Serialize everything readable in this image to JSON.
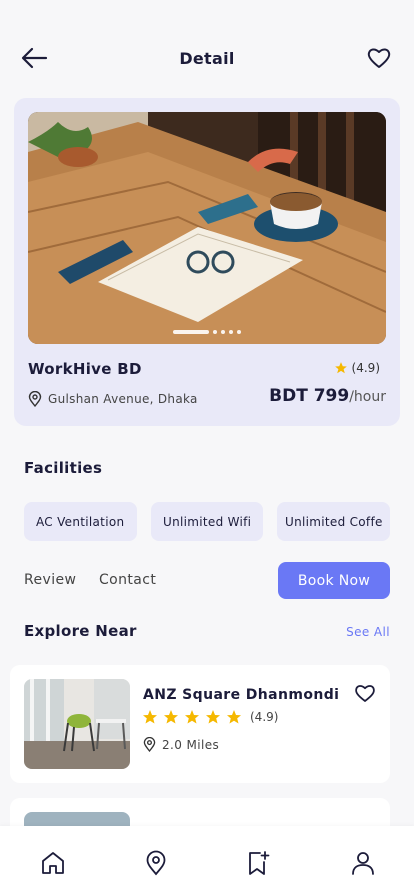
{
  "header": {
    "title": "Detail",
    "back_icon": "arrow-left-icon",
    "favorite_icon": "heart-outline-icon"
  },
  "hero": {
    "name": "WorkHive BD",
    "rating": "(4.9)",
    "address": "Gulshan Avenue, Dhaka",
    "price": "BDT 799",
    "price_unit": "/hour",
    "slides_total": 5,
    "slide_active": 1
  },
  "facilities": {
    "title": "Facilities",
    "items": [
      "AC Ventilation",
      "Unlimited Wifi",
      "Unlimited Coffe"
    ]
  },
  "actions": {
    "review": "Review",
    "contact": "Contact",
    "book": "Book Now"
  },
  "explore": {
    "title": "Explore Near",
    "see_all": "See All",
    "items": [
      {
        "name": "ANZ Square Dhanmondi",
        "stars": 5,
        "rating": "(4.9)",
        "distance": "2.0 Miles"
      }
    ]
  },
  "tabbar": {
    "items": [
      "home-icon",
      "location-pin-icon",
      "bookmark-add-icon",
      "profile-icon"
    ]
  },
  "colors": {
    "accent": "#6a78f5",
    "card_bg": "#e9e9f8",
    "star": "#f5b800",
    "text": "#1c1c3a"
  }
}
